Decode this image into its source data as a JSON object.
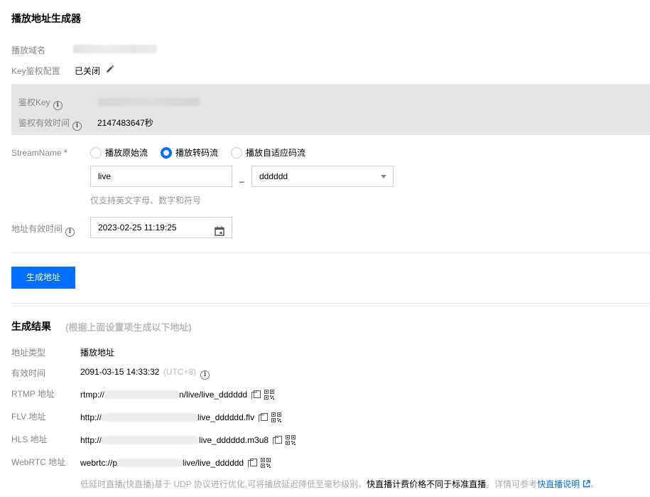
{
  "header": {
    "title": "播放地址生成器"
  },
  "domain_row": {
    "label": "播放域名"
  },
  "key_auth": {
    "label": "Key鉴权配置",
    "value": "已关闭"
  },
  "auth_box": {
    "key_label": "鉴权Key",
    "expire_label": "鉴权有效时间",
    "expire_value": "2147483647秒"
  },
  "stream": {
    "label": "StreamName",
    "required_mark": "*",
    "options": [
      "播放原始流",
      "播放转码流",
      "播放自适应码流"
    ],
    "selected_index": 1,
    "name_value": "live",
    "separator": "_",
    "template_value": "dddddd",
    "hint": "仅支持英文字母、数字和符号"
  },
  "expire_time": {
    "label": "地址有效时间",
    "value": "2023-02-25 11:19:25"
  },
  "generate_button": "生成地址",
  "result": {
    "title": "生成结果",
    "subtitle": "(根据上面设置项生成以下地址)",
    "type_label": "地址类型",
    "type_value": "播放地址",
    "valid_label": "有效时间",
    "valid_value": "2091-03-15 14:33:32",
    "valid_tz": "(UTC+8)",
    "rows": [
      {
        "label": "RTMP 地址",
        "prefix": "rtmp://",
        "suffix": "n/live/live_dddddd"
      },
      {
        "label": "FLV 地址",
        "prefix": "http://",
        "suffix": "live_dddddd.flv"
      },
      {
        "label": "HLS 地址",
        "prefix": "http://",
        "suffix": "live_dddddd.m3u8"
      },
      {
        "label": "WebRTC 地址",
        "prefix": "webrtc://p",
        "suffix": "live/live_dddddd"
      }
    ],
    "note_pre": "低延时直播(快直播)基于 UDP 协议进行优化,可将播放延迟降低至毫秒级别。",
    "note_bold": "快直播计费价格不同于标准直播",
    "note_mid": "。详情可参考",
    "note_link": "快直播说明",
    "note_end": "。"
  },
  "colors": {
    "accent": "#006eff",
    "gray_box": "#e5e5e5",
    "label": "#888888"
  }
}
